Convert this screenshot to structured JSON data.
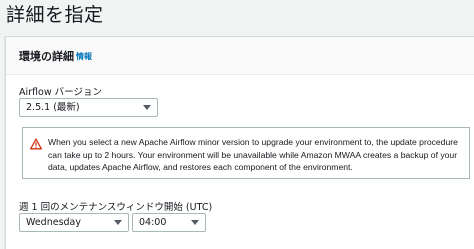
{
  "page": {
    "title": "詳細を指定"
  },
  "panel": {
    "title": "環境の詳細",
    "info_link": "情報"
  },
  "airflow_version": {
    "label": "Airflow バージョン",
    "selected": "2.5.1 (最新)"
  },
  "alert": {
    "icon": "warning-icon",
    "text": "When you select a new Apache Airflow minor version to upgrade your environment to, the update procedure can take up to 2 hours. Your environment will be unavailable while Amazon MWAA creates a backup of your data, updates Apache Airflow, and restores each component of the environment.",
    "color": "#d13212"
  },
  "maintenance_window": {
    "label": "週 1 回のメンテナンスウィンドウ開始 (UTC)",
    "day": "Wednesday",
    "time": "04:00"
  }
}
